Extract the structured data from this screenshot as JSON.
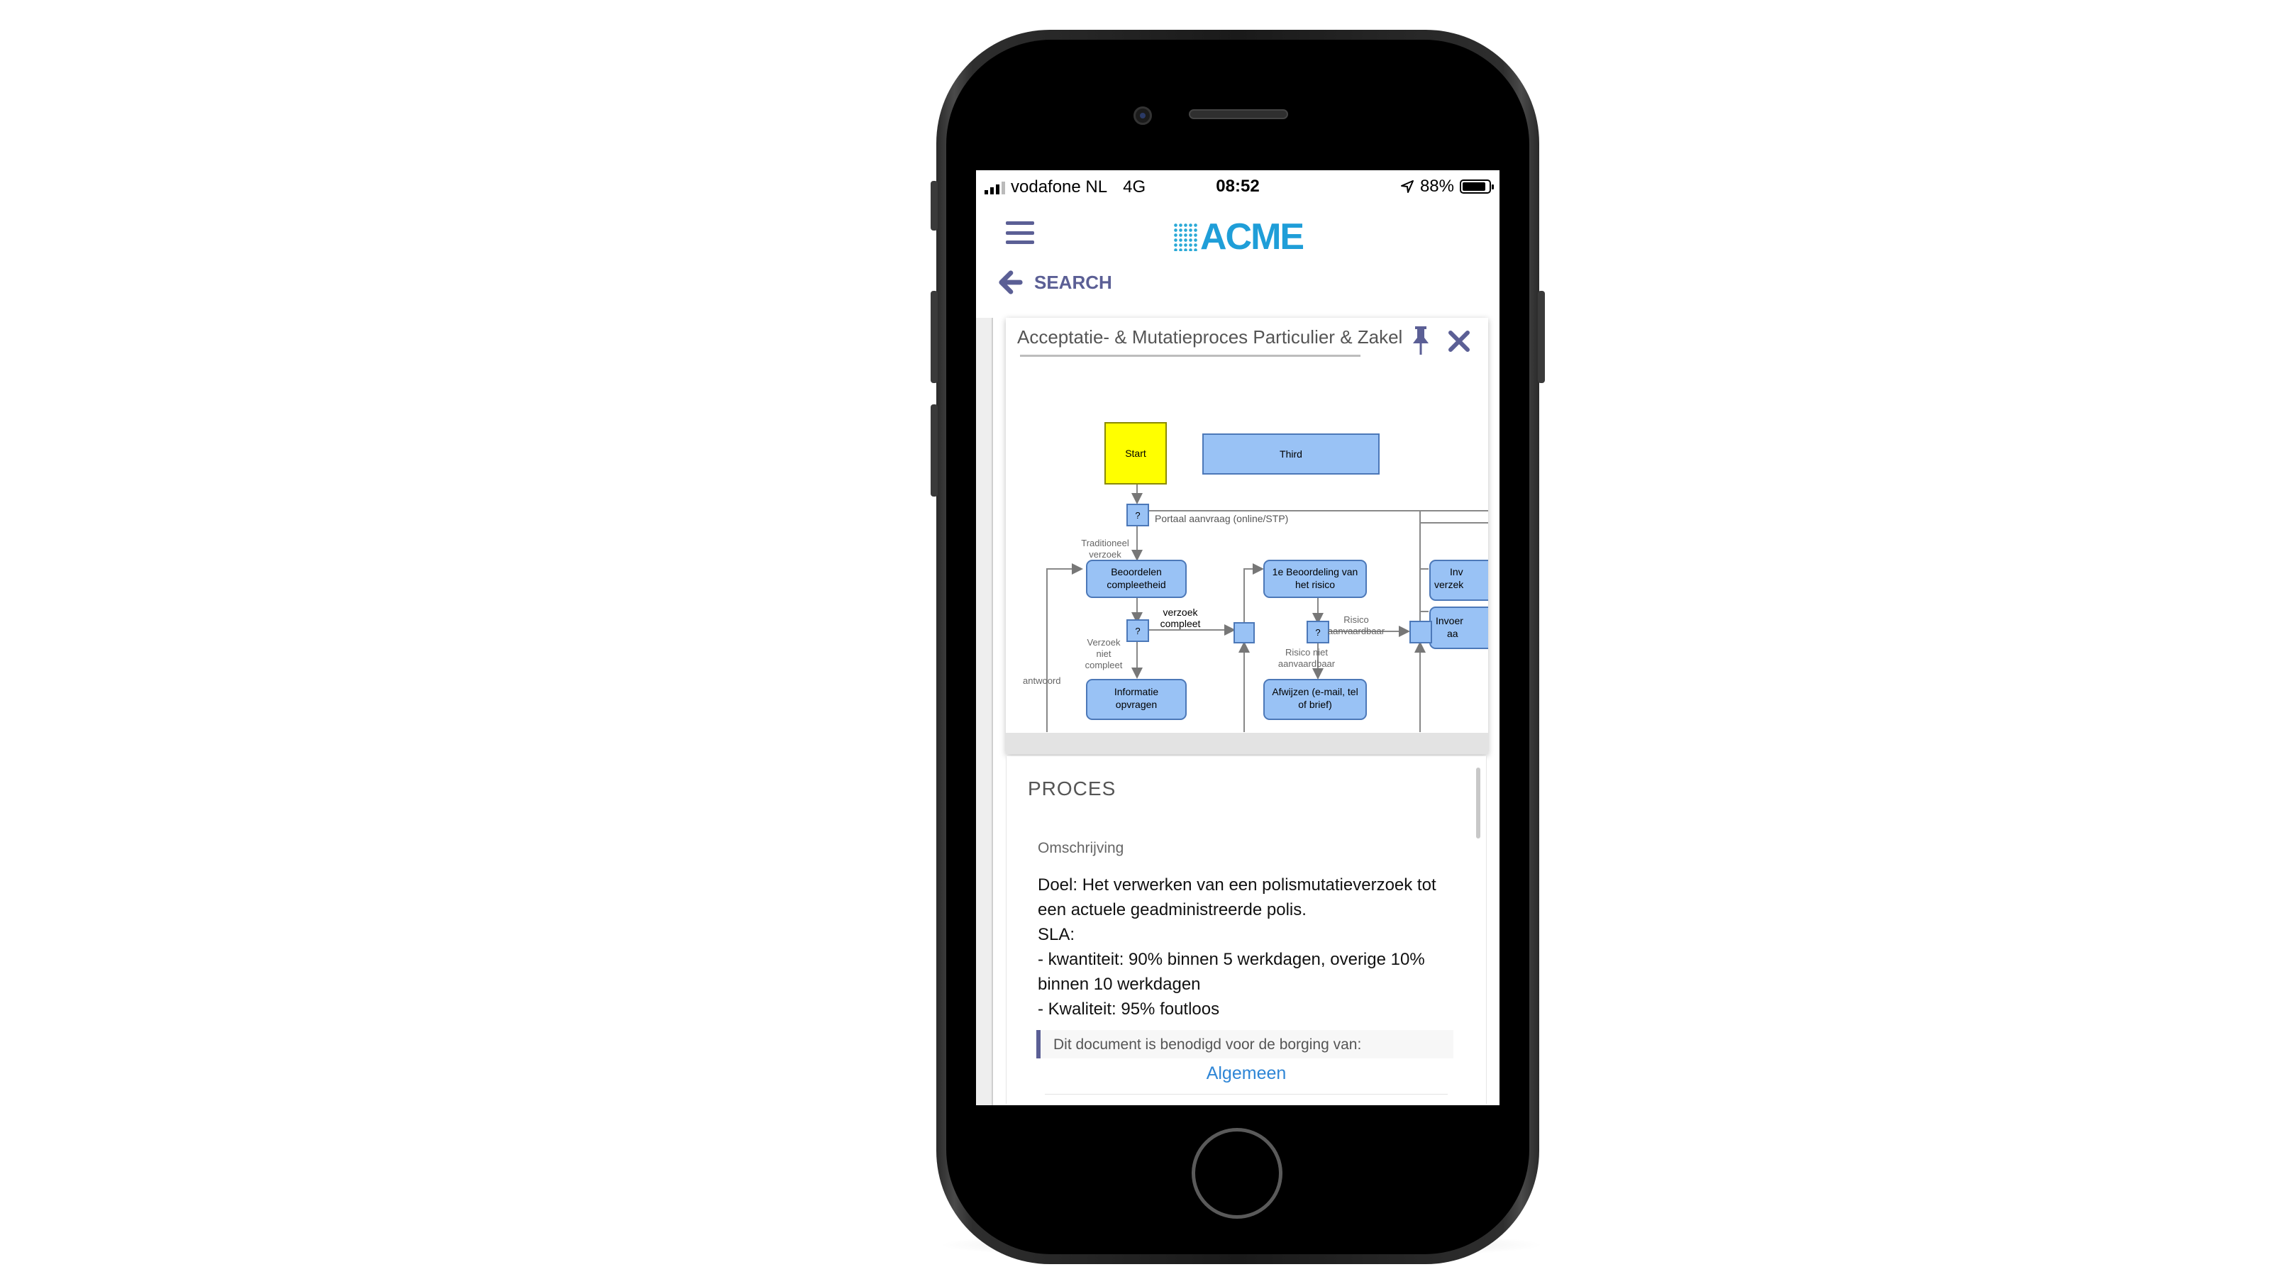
{
  "status_bar": {
    "carrier": "vodafone NL",
    "network": "4G",
    "time": "08:52",
    "battery": "88%",
    "battery_level": 0.88
  },
  "app": {
    "logo": "ACME"
  },
  "nav": {
    "back_label": "SEARCH"
  },
  "card": {
    "title": "Acceptatie- & Mutatieproces Particulier & Zakel"
  },
  "diagram": {
    "nodes": {
      "start": "Start",
      "third": "Third",
      "q1": "?",
      "q2": "?",
      "q3": "?",
      "beoordelen1": "Beoordelen",
      "beoordelen2": "compleetheid",
      "beoordeling1": "1e Beoordeling van",
      "beoordeling2": "het risico",
      "informatie1": "Informatie",
      "informatie2": "opvragen",
      "afwijzen1": "Afwijzen (e-mail, tel",
      "afwijzen2": "of brief)",
      "inv1a": "Inv",
      "inv1b": "verzek",
      "inv2a": "Invoer",
      "inv2b": "aa"
    },
    "labels": {
      "portaal": "Portaal aanvraag (online/STP)",
      "trad1": "Traditioneel",
      "trad2": "verzoek",
      "compleet1": "verzoek",
      "compleet2": "compleet",
      "niet1": "Verzoek",
      "niet2": "niet",
      "niet3": "compleet",
      "risico1": "Risico",
      "risico2": "aanvaardbaar",
      "rniet1": "Risico niet",
      "rniet2": "aanvaardbaar",
      "antwoord": "antwoord"
    },
    "colors": {
      "start": "#ffff00",
      "box": "#99c2f5",
      "box_border": "#4c78b8",
      "line": "#777777"
    }
  },
  "proces": {
    "title": "PROCES",
    "omschrijving_label": "Omschrijving",
    "description_lines": [
      "Doel: Het verwerken van een polismutatieverzoek tot",
      "een actuele geadministreerde polis.",
      "SLA:",
      "- kwantiteit: 90% binnen 5 werkdagen, overige 10%",
      "binnen 10 werkdagen",
      "- Kwaliteit: 95% foutloos"
    ],
    "borging_text": "Dit document is benodigd voor de borging van:",
    "borging_link": "Algemeen"
  },
  "colors": {
    "accent": "#5b5f95",
    "logo_blue": "#1f9ed8",
    "link": "#2f86d6"
  }
}
